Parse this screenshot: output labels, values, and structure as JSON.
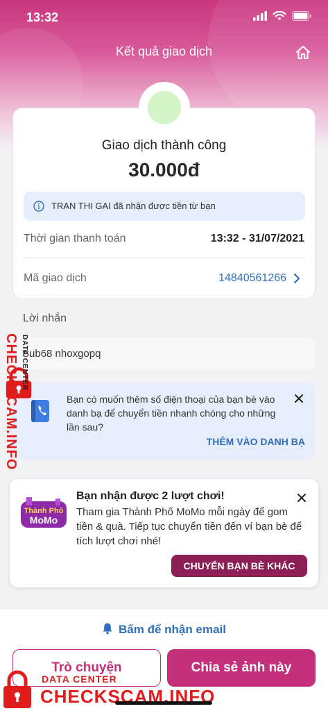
{
  "status_bar": {
    "time": "13:32"
  },
  "header": {
    "title": "Kết quả giao dịch",
    "home_icon": "home-icon"
  },
  "result": {
    "status_title": "Giao dịch thành công",
    "amount": "30.000đ",
    "info_text": "TRAN THI GAI đã nhận được tiền từ bạn",
    "payment_time_label": "Thời gian thanh toán",
    "payment_time_value": "13:32 - 31/07/2021",
    "transaction_id_label": "Mã giao dịch",
    "transaction_id_value": "14840561266"
  },
  "message": {
    "label": "Lời nhắn",
    "text": "Sub68 nhoxgopq"
  },
  "contact_prompt": {
    "text": "Bạn có muốn thêm số điện thoại của bạn bè vào danh bạ để chuyển tiền nhanh chóng cho những lần sau?",
    "action": "THÊM VÀO DANH BẠ"
  },
  "game_promo": {
    "logo_text_1": "Thành Phố",
    "logo_text_2": "MoMo",
    "title": "Bạn nhận được 2 lượt chơi!",
    "description": "Tham gia Thành Phố MoMo mỗi ngày để gom tiền & quà. Tiếp tục chuyển tiền đến ví bạn bè để tích lượt chơi nhé!",
    "button": "CHUYỂN BẠN BÈ KHÁC"
  },
  "bottom": {
    "email_link": "Bấm để nhận email",
    "chat_button": "Trò chuyện",
    "share_button": "Chia sẻ ảnh này"
  },
  "watermark": {
    "vertical_text": "CHECKSCAM.INFO",
    "vertical_sub": "DATA CENTER",
    "bottom_sub": "DATA CENTER",
    "bottom_text": "CHECKSCAM.INFO"
  },
  "colors": {
    "brand": "#c4307a",
    "link": "#2f6fb7",
    "watermark": "#e11c1c",
    "promo_button": "#8b1f56"
  }
}
